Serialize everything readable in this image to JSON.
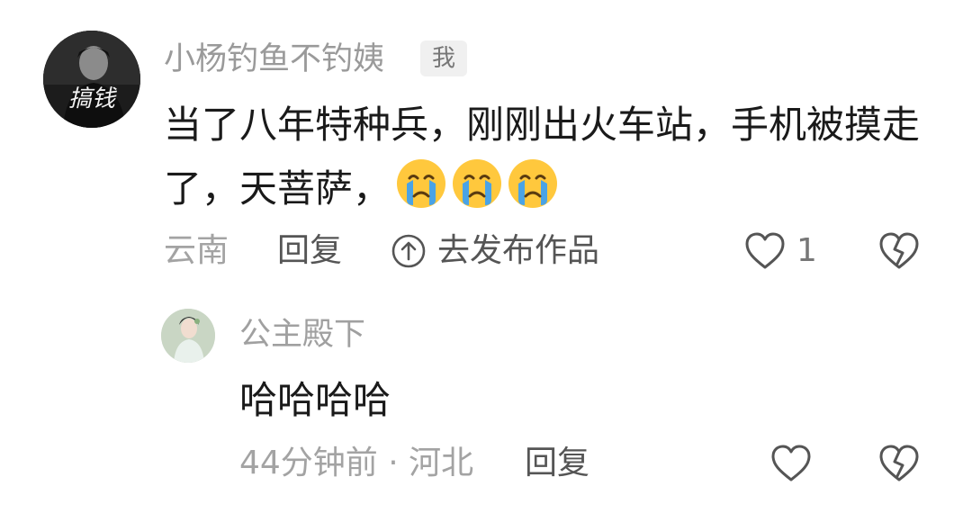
{
  "comment": {
    "username": "小杨钓鱼不钓姨",
    "author_badge": "我",
    "text": "当了八年特种兵，刚刚出火车站，手机被摸走了，天菩萨，",
    "emoji_names": [
      "crying-face-emoji",
      "crying-face-emoji",
      "crying-face-emoji"
    ],
    "avatar_text": "搞钱",
    "location": "云南",
    "reply_label": "回复",
    "publish_label": "去发布作品",
    "like_count": "1"
  },
  "reply": {
    "username": "公主殿下",
    "text": "哈哈哈哈",
    "time_location": "44分钟前 · 河北",
    "reply_label": "回复"
  },
  "colors": {
    "text": "#1a1a1a",
    "meta": "#a3a3a3",
    "username": "#9a9a9a",
    "icon": "#555555"
  }
}
